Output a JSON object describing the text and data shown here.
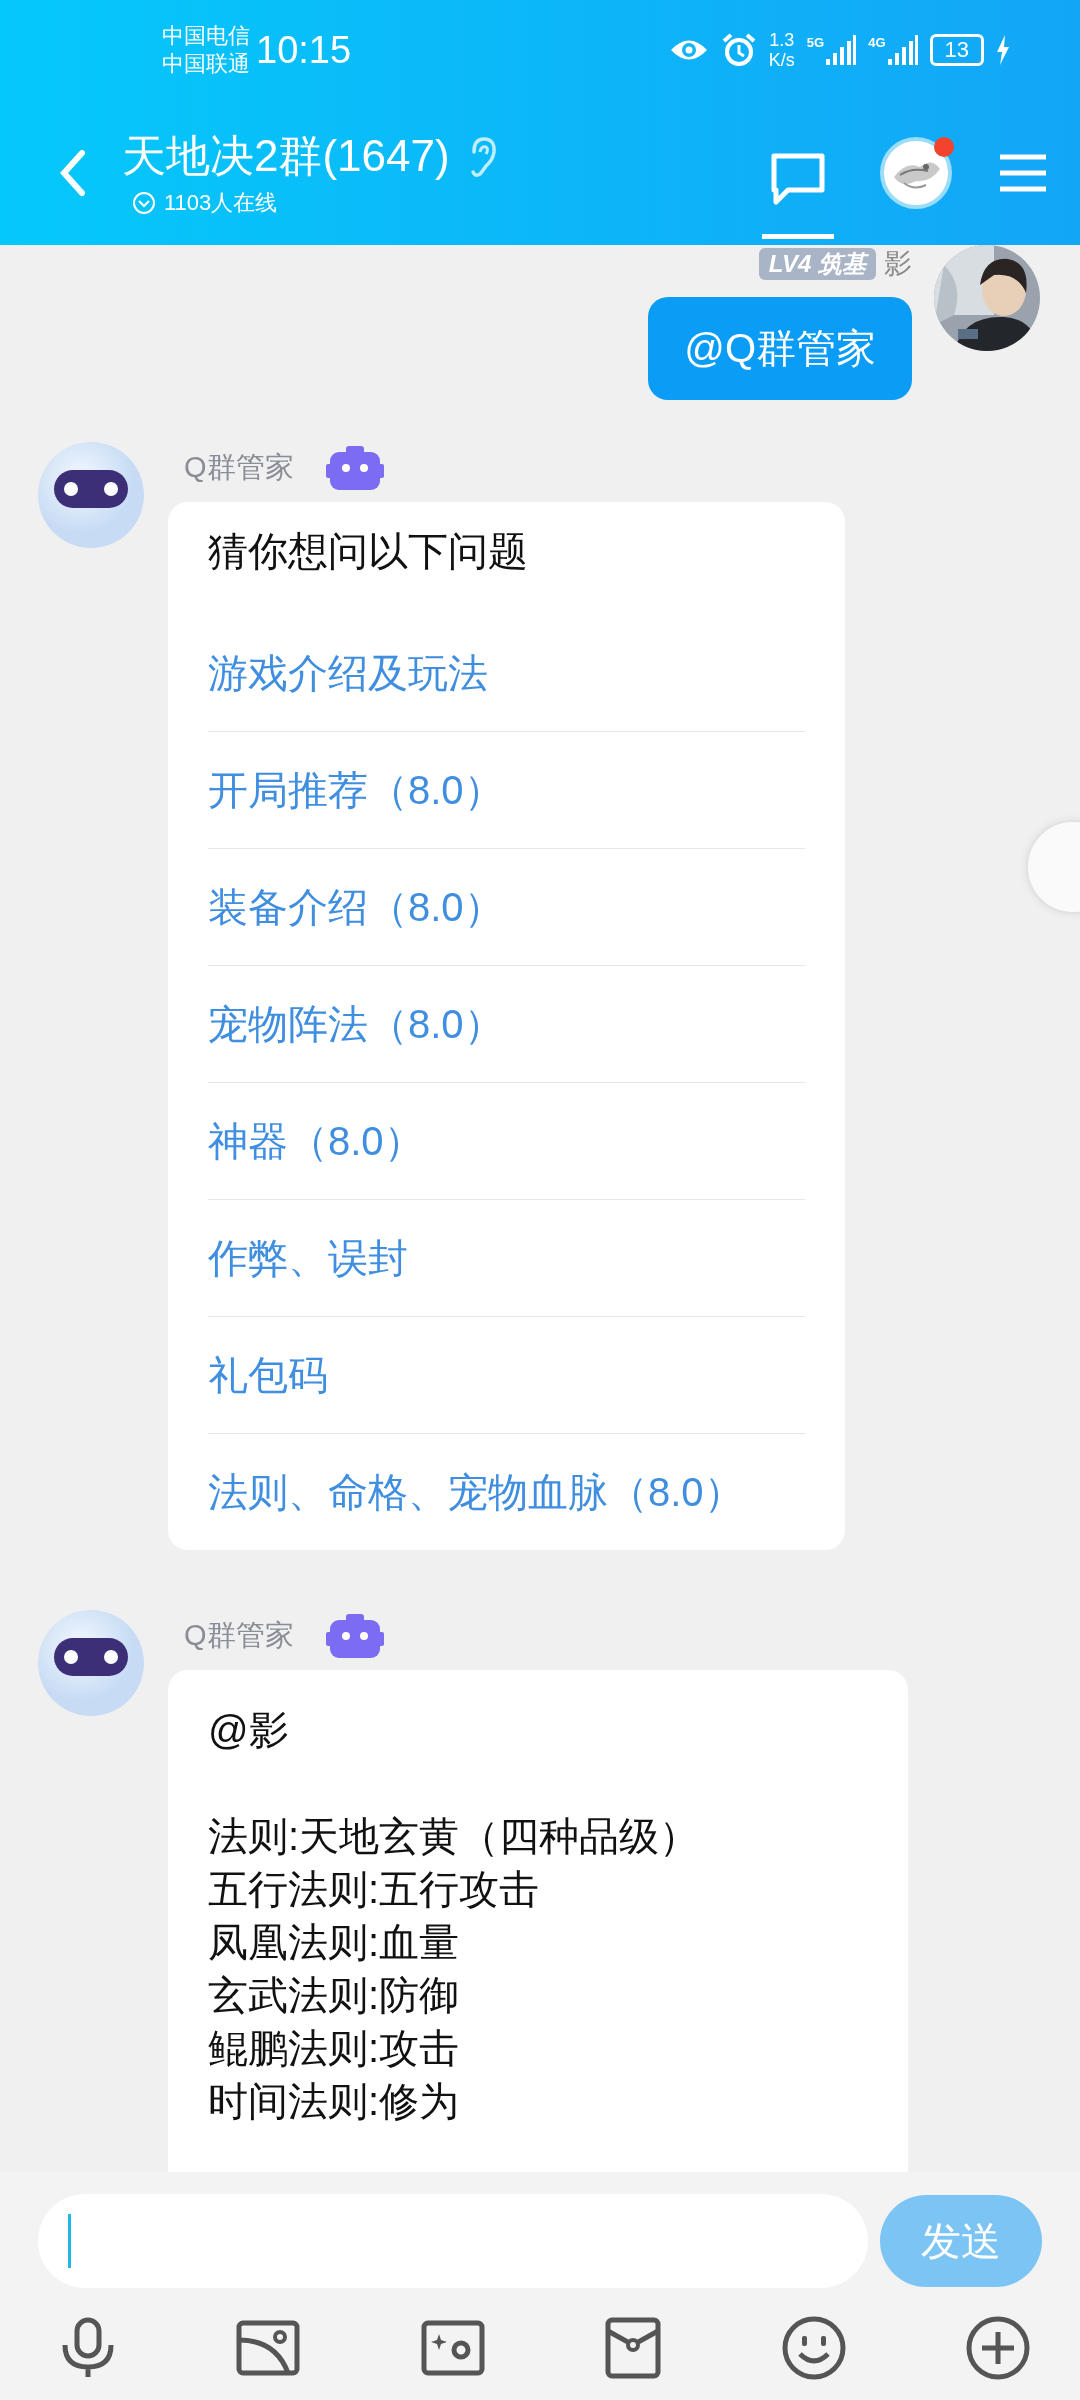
{
  "status_bar": {
    "carriers": [
      "中国电信",
      "中国联通"
    ],
    "time": "10:15",
    "net_speed": [
      "1.3",
      "K/s"
    ],
    "signals": [
      "5G",
      "4G"
    ],
    "battery": "13"
  },
  "header": {
    "title": "天地决2群(1647)",
    "online": "1103人在线",
    "chat_selected": true,
    "avatar_badge": true
  },
  "messages": [
    {
      "kind": "outgoing",
      "badge": "LV4 筑基",
      "sender": "影",
      "text": "@Q群管家"
    },
    {
      "kind": "suggestions",
      "sender": "Q群管家",
      "title": "猜你想问以下问题",
      "items": [
        "游戏介绍及玩法",
        "开局推荐（8.0）",
        "装备介绍（8.0）",
        "宠物阵法（8.0）",
        "神器（8.0）",
        "作弊、误封",
        "礼包码",
        "法则、命格、宠物血脉（8.0）"
      ]
    },
    {
      "kind": "text",
      "sender": "Q群管家",
      "paragraphs": [
        [
          "@影"
        ],
        [
          "法则:天地玄黄（四种品级）",
          "五行法则:五行攻击",
          "凤凰法则:血量",
          "玄武法则:防御",
          "鲲鹏法则:攻击",
          "时间法则:修为"
        ]
      ]
    }
  ],
  "composer": {
    "send": "发送"
  }
}
